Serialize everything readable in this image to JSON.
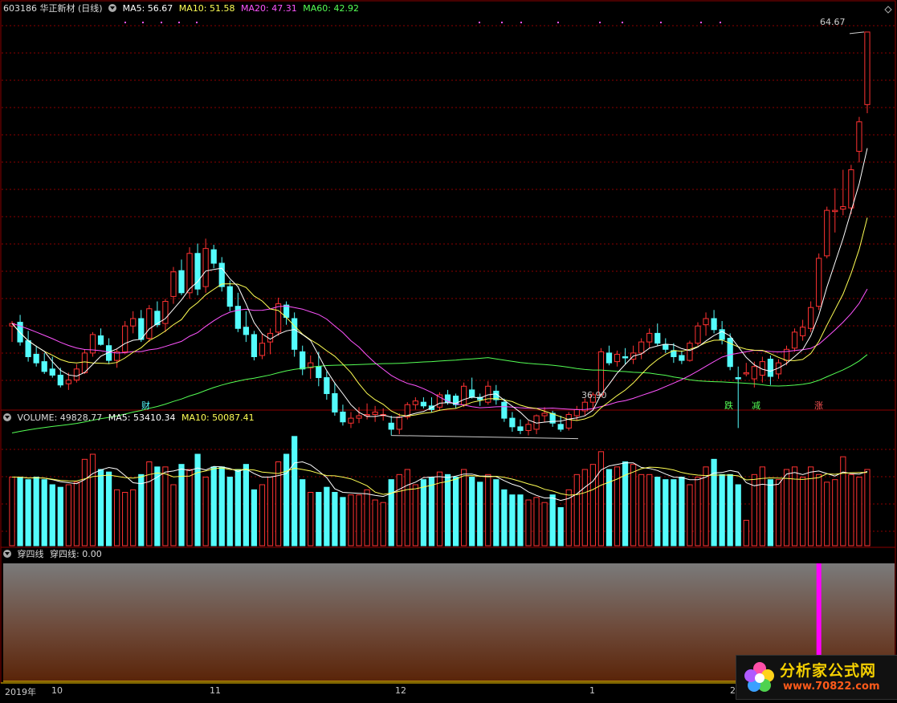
{
  "header": {
    "stock": "603186 华正新材 (日线)",
    "ma5": "MA5: 56.67",
    "ma10": "MA10: 51.58",
    "ma20": "MA20: 47.31",
    "ma60": "MA60: 42.92"
  },
  "volume_header": {
    "title": "VOLUME: 49828.77",
    "ma5": "MA5: 53410.34",
    "ma10": "MA10: 50087.41"
  },
  "indicator_header": {
    "name": "穿四线",
    "value": "穿四线: 0.00"
  },
  "annotations": {
    "high": "64.67",
    "low": "36.90",
    "cai": "财",
    "die": "跌",
    "jian": "减",
    "zhang": "涨"
  },
  "x_axis": [
    "2019年",
    "10",
    "11",
    "12",
    "1",
    "2"
  ],
  "watermark": {
    "line1": "分析家公式网",
    "line2": "www.70822.com"
  },
  "colors": {
    "up": "#ff3232",
    "down": "#54fcfc",
    "ma5": "#ffffff",
    "ma10": "#ffff54",
    "ma20": "#ff54ff",
    "ma60": "#54ff54",
    "grid": "#8b0000",
    "signal": "#ff00ff"
  },
  "chart_data": {
    "type": "candlestick",
    "ylim": [
      35.2,
      66.0
    ],
    "candles": [
      [
        40.8,
        41.2,
        39.5,
        41.0
      ],
      [
        41.1,
        41.7,
        39.2,
        39.5
      ],
      [
        39.6,
        40.4,
        37.9,
        38.3
      ],
      [
        38.5,
        39.2,
        37.5,
        37.8
      ],
      [
        37.9,
        38.6,
        36.9,
        37.1
      ],
      [
        37.3,
        38.3,
        36.6,
        36.8
      ],
      [
        36.8,
        37.4,
        35.8,
        36.0
      ],
      [
        36.1,
        37.0,
        35.6,
        36.4
      ],
      [
        36.4,
        37.7,
        36.2,
        37.3
      ],
      [
        37.0,
        38.9,
        36.9,
        38.6
      ],
      [
        38.6,
        40.3,
        38.3,
        40.1
      ],
      [
        40.0,
        40.6,
        39.2,
        39.3
      ],
      [
        39.2,
        39.8,
        37.7,
        38.0
      ],
      [
        38.0,
        38.9,
        37.4,
        38.7
      ],
      [
        38.7,
        41.2,
        38.5,
        40.8
      ],
      [
        40.8,
        42.0,
        40.2,
        41.4
      ],
      [
        41.4,
        42.1,
        39.5,
        39.7
      ],
      [
        39.8,
        42.5,
        39.5,
        42.2
      ],
      [
        42.0,
        42.8,
        40.7,
        40.9
      ],
      [
        41.0,
        43.0,
        40.3,
        42.8
      ],
      [
        43.2,
        45.6,
        42.6,
        45.2
      ],
      [
        45.3,
        46.2,
        43.3,
        43.5
      ],
      [
        43.5,
        47.2,
        43.0,
        46.7
      ],
      [
        46.7,
        47.5,
        43.3,
        43.8
      ],
      [
        44.0,
        47.9,
        43.5,
        47.1
      ],
      [
        47.0,
        47.4,
        45.5,
        45.9
      ],
      [
        45.9,
        46.4,
        43.6,
        44.0
      ],
      [
        44.0,
        44.5,
        42.0,
        42.4
      ],
      [
        42.4,
        43.5,
        40.3,
        40.6
      ],
      [
        40.7,
        42.0,
        39.5,
        40.1
      ],
      [
        40.1,
        40.4,
        38.0,
        38.3
      ],
      [
        38.4,
        40.2,
        38.1,
        39.4
      ],
      [
        39.5,
        40.6,
        38.5,
        40.2
      ],
      [
        40.3,
        43.1,
        40.0,
        42.6
      ],
      [
        42.5,
        42.8,
        40.9,
        41.5
      ],
      [
        41.4,
        41.9,
        38.3,
        38.9
      ],
      [
        38.7,
        39.2,
        36.8,
        37.3
      ],
      [
        37.4,
        38.4,
        36.5,
        37.8
      ],
      [
        37.5,
        38.7,
        35.9,
        36.6
      ],
      [
        36.6,
        37.1,
        34.8,
        35.3
      ],
      [
        35.3,
        36.2,
        33.5,
        33.8
      ],
      [
        33.8,
        34.4,
        32.7,
        33.0
      ],
      [
        32.9,
        33.8,
        32.5,
        33.3
      ],
      [
        33.3,
        34.2,
        32.9,
        33.5
      ],
      [
        33.5,
        34.5,
        33.2,
        33.6
      ],
      [
        33.6,
        34.3,
        33.0,
        33.8
      ],
      [
        33.5,
        34.1,
        33.1,
        33.6
      ],
      [
        32.9,
        33.5,
        31.9,
        32.4
      ],
      [
        32.4,
        33.7,
        32.0,
        33.4
      ],
      [
        33.4,
        34.6,
        33.2,
        34.4
      ],
      [
        34.4,
        35.0,
        34.0,
        34.7
      ],
      [
        34.6,
        35.0,
        34.1,
        34.3
      ],
      [
        34.3,
        35.0,
        33.8,
        34.0
      ],
      [
        34.2,
        35.4,
        33.9,
        35.2
      ],
      [
        35.2,
        35.6,
        34.4,
        34.6
      ],
      [
        35.1,
        35.3,
        34.1,
        34.4
      ],
      [
        34.4,
        36.2,
        34.2,
        35.9
      ],
      [
        35.6,
        36.6,
        34.9,
        35.0
      ],
      [
        35.0,
        35.3,
        34.3,
        34.8
      ],
      [
        34.6,
        36.3,
        34.4,
        35.9
      ],
      [
        35.5,
        36.0,
        34.4,
        34.8
      ],
      [
        34.6,
        34.9,
        33.0,
        33.3
      ],
      [
        33.3,
        33.8,
        32.2,
        32.6
      ],
      [
        32.6,
        33.2,
        32.0,
        32.3
      ],
      [
        32.3,
        33.1,
        31.9,
        32.8
      ],
      [
        32.4,
        33.6,
        32.0,
        33.5
      ],
      [
        33.5,
        34.2,
        33.0,
        33.7
      ],
      [
        33.7,
        33.9,
        32.6,
        32.9
      ],
      [
        32.8,
        33.5,
        32.2,
        32.4
      ],
      [
        32.5,
        33.8,
        32.3,
        33.6
      ],
      [
        33.5,
        34.3,
        33.1,
        34.0
      ],
      [
        33.9,
        34.9,
        33.5,
        34.6
      ],
      [
        34.6,
        35.4,
        34.1,
        35.2
      ],
      [
        35.2,
        39.0,
        35.0,
        38.7
      ],
      [
        38.6,
        39.2,
        37.6,
        37.8
      ],
      [
        37.9,
        38.8,
        37.5,
        38.5
      ],
      [
        38.3,
        39.0,
        37.7,
        38.2
      ],
      [
        38.1,
        39.2,
        37.7,
        38.6
      ],
      [
        38.6,
        39.8,
        38.1,
        39.5
      ],
      [
        39.5,
        40.6,
        39.0,
        40.2
      ],
      [
        40.2,
        41.0,
        39.2,
        39.4
      ],
      [
        39.3,
        39.8,
        38.6,
        38.9
      ],
      [
        38.8,
        39.4,
        37.8,
        38.3
      ],
      [
        38.4,
        38.8,
        37.7,
        38.0
      ],
      [
        38.0,
        39.6,
        37.9,
        39.4
      ],
      [
        39.4,
        41.1,
        39.2,
        40.8
      ],
      [
        40.9,
        41.9,
        40.0,
        41.4
      ],
      [
        41.4,
        42.1,
        40.2,
        40.5
      ],
      [
        40.5,
        41.2,
        39.3,
        39.7
      ],
      [
        39.8,
        40.2,
        37.2,
        37.5
      ],
      [
        36.6,
        37.5,
        32.5,
        36.5
      ],
      [
        36.9,
        37.8,
        36.7,
        37.0
      ],
      [
        36.5,
        37.9,
        35.8,
        37.5
      ],
      [
        36.8,
        38.3,
        36.2,
        37.9
      ],
      [
        38.1,
        38.4,
        36.0,
        36.7
      ],
      [
        36.9,
        38.1,
        36.5,
        37.8
      ],
      [
        38.0,
        39.2,
        37.6,
        38.9
      ],
      [
        39.0,
        40.6,
        38.7,
        40.3
      ],
      [
        40.0,
        41.3,
        39.6,
        40.7
      ],
      [
        40.6,
        42.8,
        40.3,
        42.3
      ],
      [
        42.4,
        46.7,
        42.1,
        46.3
      ],
      [
        46.5,
        50.5,
        46.3,
        50.2
      ],
      [
        50.1,
        52.0,
        48.4,
        50.2
      ],
      [
        50.3,
        53.5,
        49.8,
        50.5
      ],
      [
        50.4,
        53.9,
        49.9,
        53.5
      ],
      [
        55.0,
        57.8,
        54.1,
        57.4
      ],
      [
        58.8,
        64.7,
        58.1,
        64.7
      ]
    ],
    "volume": [
      27000,
      27000,
      26000,
      27000,
      26000,
      24000,
      23000,
      24000,
      25000,
      34000,
      36000,
      30000,
      29000,
      22000,
      21000,
      22000,
      28000,
      33000,
      31000,
      31000,
      24000,
      32000,
      30000,
      36000,
      27000,
      31000,
      31000,
      27000,
      30000,
      32000,
      22000,
      24000,
      27000,
      33000,
      36000,
      43000,
      26000,
      21000,
      21000,
      23000,
      21000,
      19000,
      20000,
      20000,
      22000,
      18000,
      17000,
      26000,
      28000,
      30000,
      24000,
      26000,
      27000,
      29000,
      28000,
      27000,
      30000,
      27000,
      25000,
      28000,
      26000,
      22000,
      20000,
      20000,
      18000,
      19000,
      17000,
      20000,
      15000,
      22000,
      28000,
      30000,
      32000,
      37000,
      30000,
      31000,
      33000,
      32000,
      28000,
      28000,
      27000,
      26000,
      26000,
      27000,
      24000,
      27000,
      31000,
      34000,
      28000,
      28000,
      24000,
      10000,
      28000,
      31000,
      26000,
      26000,
      30000,
      31000,
      27000,
      31000,
      28000,
      25000,
      26000,
      35000,
      28000,
      27000,
      30000
    ]
  },
  "indicator": {
    "signal_bar_index": 100
  }
}
